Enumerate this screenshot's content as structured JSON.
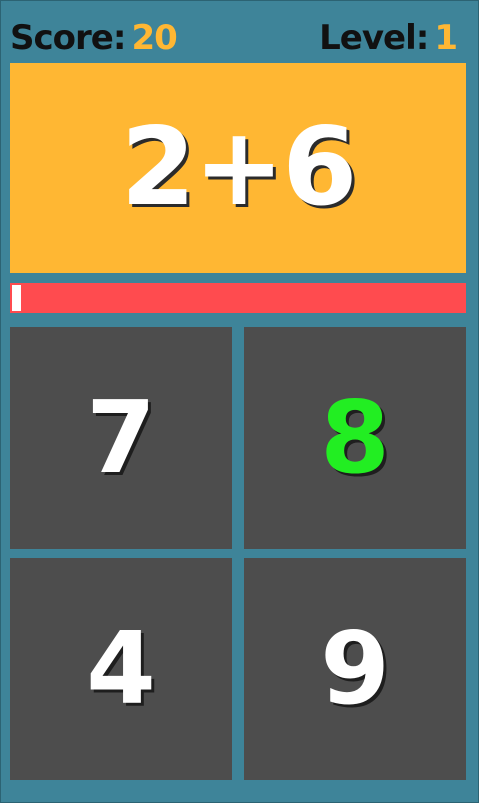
{
  "hud": {
    "score_label": "Score:",
    "score_value": "20",
    "level_label": "Level:",
    "level_value": "1"
  },
  "question": {
    "text": "2+6"
  },
  "timer": {
    "remaining_fraction": 0.02
  },
  "answers": [
    {
      "label": "7",
      "highlighted": false
    },
    {
      "label": "8",
      "highlighted": true
    },
    {
      "label": "4",
      "highlighted": false
    },
    {
      "label": "9",
      "highlighted": false
    }
  ],
  "colors": {
    "background": "#3e8499",
    "accent": "#ffb733",
    "timer_bar": "#ff4b4f",
    "tile": "#4d4d4d",
    "highlight": "#22ee22"
  }
}
